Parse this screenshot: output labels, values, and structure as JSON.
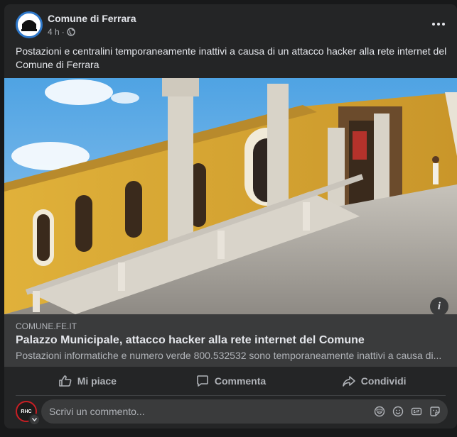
{
  "post": {
    "author": "Comune di Ferrara",
    "time": "4 h",
    "separator": "·",
    "text": "Postazioni e centralini temporaneamente inattivi a causa di un attacco hacker alla rete internet del Comune di Ferrara",
    "more_icon": "more-horizontal-icon",
    "privacy_icon": "globe-icon"
  },
  "link": {
    "domain": "COMUNE.FE.IT",
    "title": "Palazzo Municipale, attacco hacker alla rete internet del Comune",
    "description": "Postazioni informatiche e numero verde 800.532532 sono temporaneamente inattivi a causa di...",
    "info_glyph": "i"
  },
  "actions": {
    "like": "Mi piace",
    "comment": "Commenta",
    "share": "Condividi"
  },
  "comment_box": {
    "placeholder": "Scrivi un commento...",
    "avatar_text": "RHC",
    "icons": [
      "sticker-icon",
      "emoji-icon",
      "gif-icon",
      "sticker-face-icon"
    ]
  },
  "colors": {
    "background": "#18191a",
    "card": "#242526",
    "text_primary": "#e4e6eb",
    "text_secondary": "#b0b3b8",
    "link_preview": "#3a3b3c",
    "avatar_ring": "#2d77c9"
  }
}
